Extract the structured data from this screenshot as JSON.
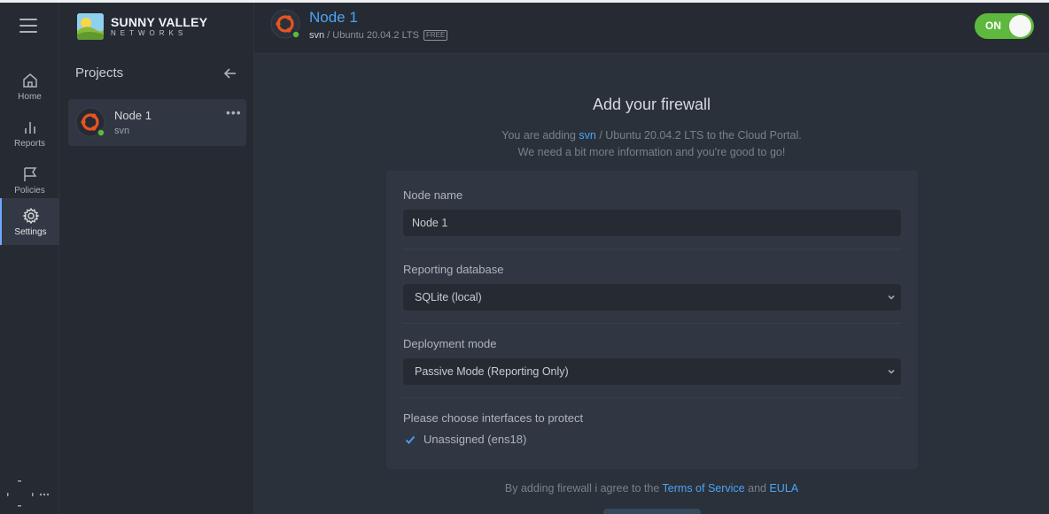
{
  "brand": {
    "line1": "SUNNY VALLEY",
    "line2": "NETWORKS"
  },
  "nav": [
    {
      "label": "Home",
      "icon": "home-icon",
      "active": false
    },
    {
      "label": "Reports",
      "icon": "bar-chart-icon",
      "active": false
    },
    {
      "label": "Policies",
      "icon": "flag-icon",
      "active": false
    },
    {
      "label": "Settings",
      "icon": "gear-icon",
      "active": true
    }
  ],
  "projects": {
    "title": "Projects",
    "items": [
      {
        "name": "Node 1",
        "org": "svn",
        "status": "online"
      }
    ]
  },
  "header": {
    "title": "Node 1",
    "org": "svn",
    "separator": " / ",
    "os": "Ubuntu 20.04.2 LTS",
    "plan_badge": "FREE",
    "toggle_label": "ON"
  },
  "colors": {
    "accent": "#4ba3f5",
    "online": "#5db83d",
    "ubuntu": "#e95420"
  },
  "main": {
    "title": "Add your firewall",
    "intro_prefix": "You are adding ",
    "intro_org": "svn",
    "intro_suffix": " / Ubuntu 20.04.2 LTS to the Cloud Portal.",
    "intro_line2": "We need a bit more information and you're good to go!",
    "form": {
      "node_name_label": "Node name",
      "node_name_value": "Node 1",
      "reporting_db_label": "Reporting database",
      "reporting_db_value": "SQLite (local)",
      "deployment_label": "Deployment mode",
      "deployment_value": "Passive Mode (Reporting Only)",
      "interfaces_label": "Please choose interfaces to protect",
      "interfaces": [
        {
          "label": "Unassigned (ens18)",
          "checked": true
        }
      ]
    },
    "terms_prefix": "By adding firewall i agree to the ",
    "terms_link": "Terms of Service",
    "terms_and": " and ",
    "eula_link": "EULA"
  }
}
